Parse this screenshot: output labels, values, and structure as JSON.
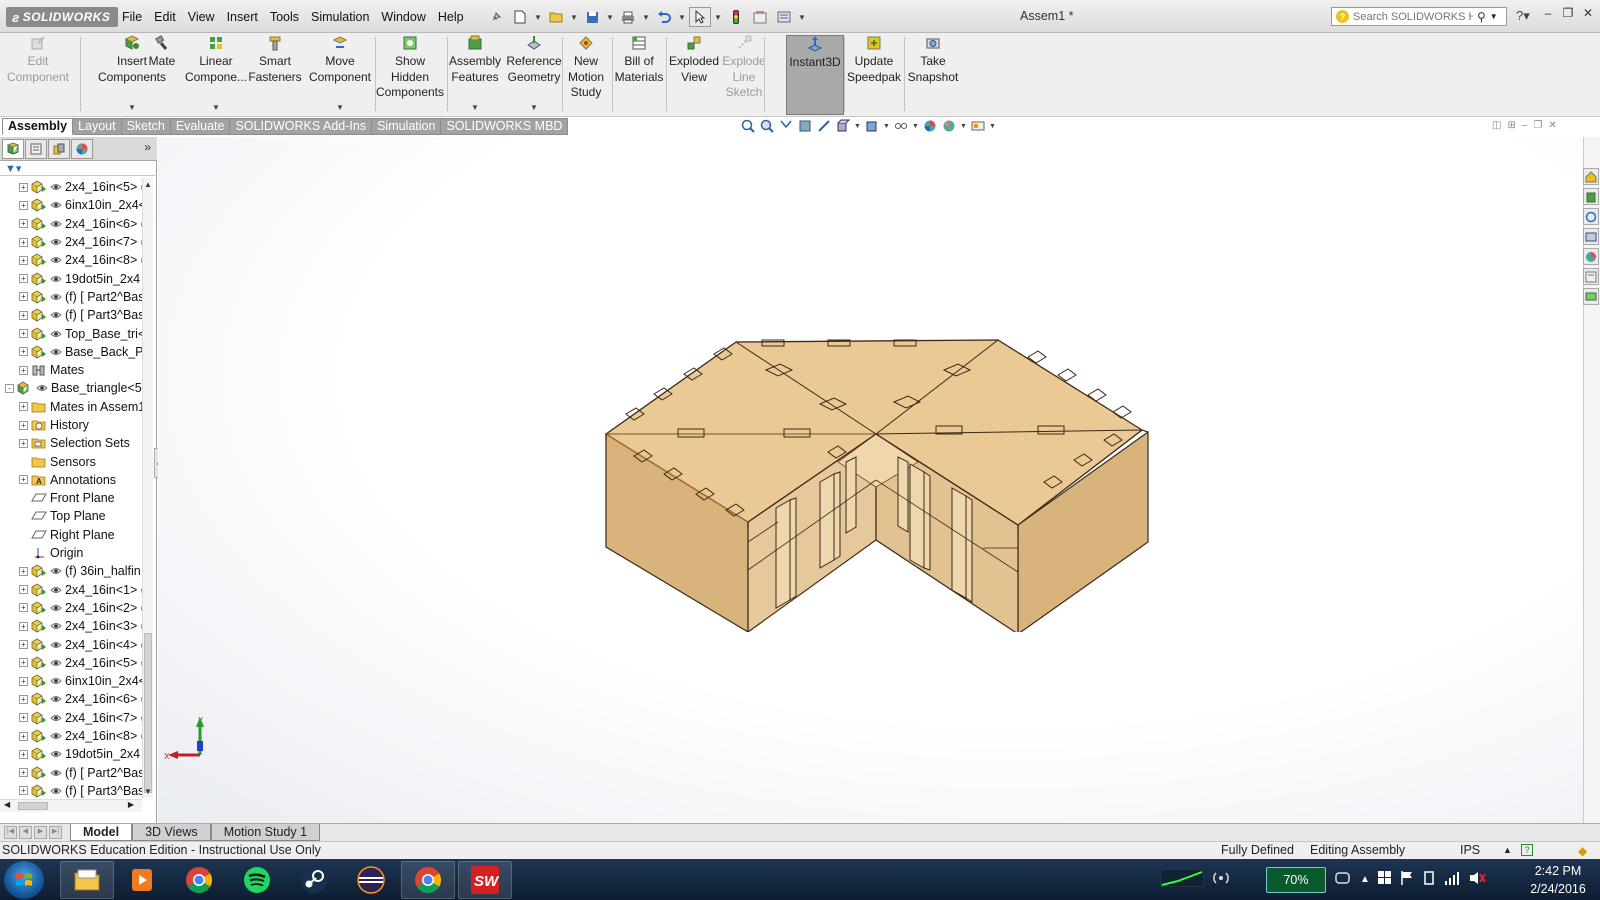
{
  "app": {
    "logo_text": "SOLIDWORKS",
    "document_title": "Assem1 *",
    "menus": [
      "File",
      "Edit",
      "View",
      "Insert",
      "Tools",
      "Simulation",
      "Window",
      "Help"
    ],
    "search_placeholder": "Search SOLIDWORKS Help"
  },
  "commands": [
    {
      "l1": "Edit",
      "l2": "Component",
      "l3": "",
      "icon": "edit-component-icon",
      "disabled": true
    },
    {
      "l1": "Insert",
      "l2": "Components",
      "l3": "",
      "icon": "insert-components-icon",
      "dropdown": true
    },
    {
      "l1": "Mate",
      "l2": "",
      "l3": "",
      "icon": "mate-icon"
    },
    {
      "l1": "Linear",
      "l2": "Compone...",
      "l3": "",
      "icon": "linear-pattern-icon",
      "dropdown": true
    },
    {
      "l1": "Smart",
      "l2": "Fasteners",
      "l3": "",
      "icon": "smart-fasteners-icon"
    },
    {
      "l1": "Move",
      "l2": "Component",
      "l3": "",
      "icon": "move-component-icon",
      "dropdown": true
    },
    {
      "l1": "Show",
      "l2": "Hidden",
      "l3": "Components",
      "icon": "show-hidden-icon"
    },
    {
      "l1": "Assembly",
      "l2": "Features",
      "l3": "",
      "icon": "assembly-features-icon",
      "dropdown": true
    },
    {
      "l1": "Reference",
      "l2": "Geometry",
      "l3": "",
      "icon": "reference-geometry-icon",
      "dropdown": true
    },
    {
      "l1": "New",
      "l2": "Motion",
      "l3": "Study",
      "icon": "motion-study-icon"
    },
    {
      "l1": "Bill of",
      "l2": "Materials",
      "l3": "",
      "icon": "bill-of-materials-icon"
    },
    {
      "l1": "Exploded",
      "l2": "View",
      "l3": "",
      "icon": "exploded-view-icon"
    },
    {
      "l1": "Explode",
      "l2": "Line",
      "l3": "Sketch",
      "icon": "explode-line-icon",
      "disabled": true
    },
    {
      "l1": "Instant3D",
      "l2": "",
      "l3": "",
      "icon": "instant3d-icon",
      "active": true
    },
    {
      "l1": "Update",
      "l2": "Speedpak",
      "l3": "",
      "icon": "speedpak-icon"
    },
    {
      "l1": "Take",
      "l2": "Snapshot",
      "l3": "",
      "icon": "snapshot-icon"
    }
  ],
  "command_tabs": [
    {
      "label": "Assembly",
      "active": true
    },
    {
      "label": "Layout"
    },
    {
      "label": "Sketch"
    },
    {
      "label": "Evaluate"
    },
    {
      "label": "SOLIDWORKS Add-Ins"
    },
    {
      "label": "Simulation"
    },
    {
      "label": "SOLIDWORKS MBD"
    }
  ],
  "tree": [
    {
      "label": "2x4_16in<5> (",
      "depth": 1,
      "kind": "part",
      "exp": "+"
    },
    {
      "label": "6inx10in_2x4<",
      "depth": 1,
      "kind": "part",
      "exp": "+"
    },
    {
      "label": "2x4_16in<6> (",
      "depth": 1,
      "kind": "part",
      "exp": "+"
    },
    {
      "label": "2x4_16in<7> (",
      "depth": 1,
      "kind": "part",
      "exp": "+"
    },
    {
      "label": "2x4_16in<8> (",
      "depth": 1,
      "kind": "part",
      "exp": "+"
    },
    {
      "label": "19dot5in_2x4",
      "depth": 1,
      "kind": "part",
      "exp": "+"
    },
    {
      "label": "(f) [ Part2^Bas",
      "depth": 1,
      "kind": "part",
      "exp": "+"
    },
    {
      "label": "(f) [ Part3^Bas",
      "depth": 1,
      "kind": "part",
      "exp": "+"
    },
    {
      "label": "Top_Base_tri<",
      "depth": 1,
      "kind": "part",
      "exp": "+"
    },
    {
      "label": "Base_Back_Pla",
      "depth": 1,
      "kind": "part",
      "exp": "+"
    },
    {
      "label": "Mates",
      "depth": 1,
      "kind": "mates",
      "exp": "+"
    },
    {
      "label": "Base_triangle<5:",
      "depth": 0,
      "kind": "assembly",
      "exp": "-"
    },
    {
      "label": "Mates in Assem1",
      "depth": 1,
      "kind": "folder",
      "exp": "+"
    },
    {
      "label": "History",
      "depth": 1,
      "kind": "history",
      "exp": "+"
    },
    {
      "label": "Selection Sets",
      "depth": 1,
      "kind": "selection",
      "exp": "+"
    },
    {
      "label": "Sensors",
      "depth": 1,
      "kind": "folder",
      "exp": ""
    },
    {
      "label": "Annotations",
      "depth": 1,
      "kind": "annotations",
      "exp": "+"
    },
    {
      "label": "Front Plane",
      "depth": 1,
      "kind": "plane",
      "exp": ""
    },
    {
      "label": "Top Plane",
      "depth": 1,
      "kind": "plane",
      "exp": ""
    },
    {
      "label": "Right Plane",
      "depth": 1,
      "kind": "plane",
      "exp": ""
    },
    {
      "label": "Origin",
      "depth": 1,
      "kind": "origin",
      "exp": ""
    },
    {
      "label": "(f) 36in_halfin",
      "depth": 1,
      "kind": "part",
      "exp": "+"
    },
    {
      "label": "2x4_16in<1> (",
      "depth": 1,
      "kind": "part",
      "exp": "+"
    },
    {
      "label": "2x4_16in<2> (",
      "depth": 1,
      "kind": "part",
      "exp": "+"
    },
    {
      "label": "2x4_16in<3> (",
      "depth": 1,
      "kind": "part",
      "exp": "+"
    },
    {
      "label": "2x4_16in<4> (",
      "depth": 1,
      "kind": "part",
      "exp": "+"
    },
    {
      "label": "2x4_16in<5> (",
      "depth": 1,
      "kind": "part",
      "exp": "+"
    },
    {
      "label": "6inx10in_2x4<",
      "depth": 1,
      "kind": "part",
      "exp": "+"
    },
    {
      "label": "2x4_16in<6> (",
      "depth": 1,
      "kind": "part",
      "exp": "+"
    },
    {
      "label": "2x4_16in<7> (",
      "depth": 1,
      "kind": "part",
      "exp": "+"
    },
    {
      "label": "2x4_16in<8> (",
      "depth": 1,
      "kind": "part",
      "exp": "+"
    },
    {
      "label": "19dot5in_2x4",
      "depth": 1,
      "kind": "part",
      "exp": "+"
    },
    {
      "label": "(f) [ Part2^Bas",
      "depth": 1,
      "kind": "part",
      "exp": "+"
    },
    {
      "label": "(f) [ Part3^Bas",
      "depth": 1,
      "kind": "part",
      "exp": "+"
    }
  ],
  "triad": {
    "x_label": "X",
    "y_label": "Y"
  },
  "bottom_tabs": [
    {
      "label": "Model",
      "active": true
    },
    {
      "label": "3D Views"
    },
    {
      "label": "Motion Study 1"
    }
  ],
  "status": {
    "left": "SOLIDWORKS Education Edition - Instructional Use Only",
    "definition": "Fully Defined",
    "mode": "Editing Assembly",
    "units": "IPS"
  },
  "taskbar": {
    "battery": "70%",
    "time": "2:42 PM",
    "date": "2/24/2016"
  },
  "colors": {
    "wood_top": "#e9c48f",
    "wood_side": "#dcb886",
    "wood_dark": "#c49a63",
    "active_tab": "#ffffff",
    "inactive_tab": "#a2a2a2"
  }
}
